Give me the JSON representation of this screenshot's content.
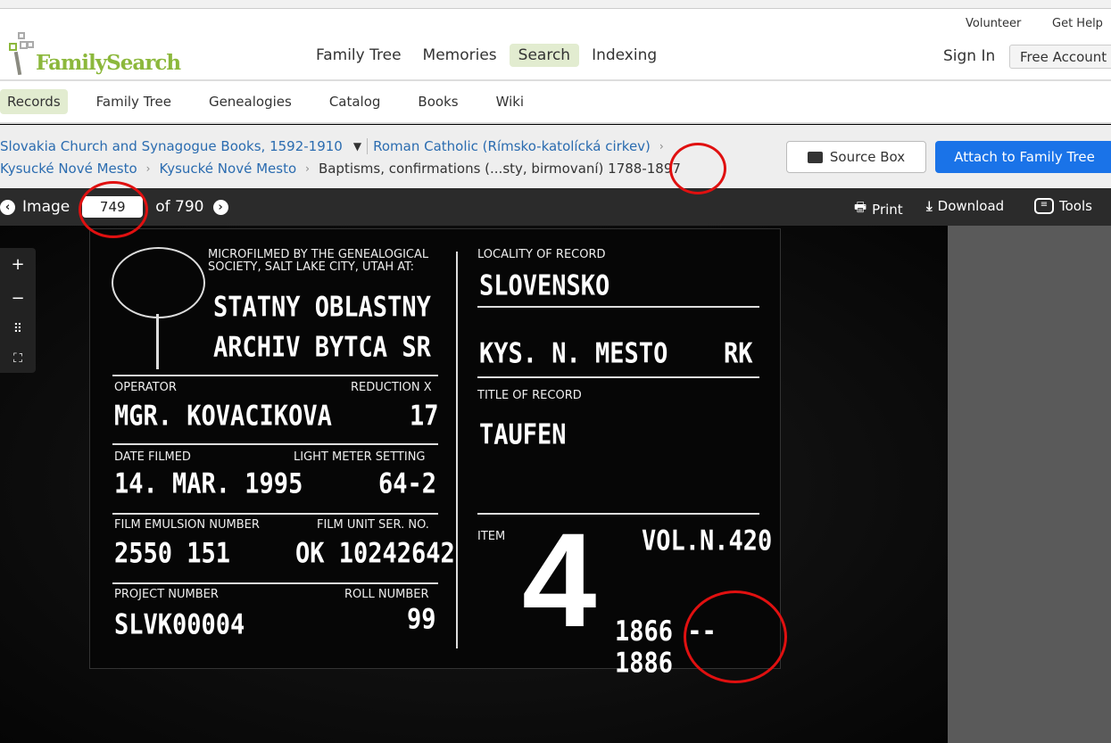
{
  "header": {
    "brand": "FamilySearch",
    "nav": [
      "Family Tree",
      "Memories",
      "Search",
      "Indexing"
    ],
    "active_nav": "Search",
    "volunteer": "Volunteer",
    "get_help": "Get Help",
    "sign_in": "Sign In",
    "free_account": "Free Account"
  },
  "subnav": {
    "items": [
      "Records",
      "Family Tree",
      "Genealogies",
      "Catalog",
      "Books",
      "Wiki"
    ]
  },
  "breadcrumb": {
    "collection": "Slovakia Church and Synagogue Books, 1592-1910",
    "religion": "Roman Catholic (Rímsko-katolícká cirkev)",
    "place1": "Kysucké Nové Mesto",
    "place2": "Kysucké Nové Mesto",
    "record": "Baptisms, confirmations (...sty, birmovaní) 1788-1897"
  },
  "actions": {
    "source_box": "Source Box",
    "attach": "Attach to Family Tree"
  },
  "toolbar": {
    "image_label": "Image",
    "image_number": "749",
    "of_label": "of 790",
    "print": "Print",
    "download": "Download",
    "tools": "Tools"
  },
  "card": {
    "microfilmed_by": "MICROFILMED BY THE GENEALOGICAL SOCIETY, SALT LAKE CITY, UTAH AT:",
    "archive_line1": "STATNY OBLASTNY",
    "archive_line2": "ARCHIV BYTCA SR",
    "operator_label": "OPERATOR",
    "operator": "MGR. KOVACIKOVA",
    "reduction_label": "REDUCTION X",
    "reduction": "17",
    "date_label": "DATE FILMED",
    "date": "14. MAR. 1995",
    "light_label": "LIGHT METER SETTING",
    "light": "64-2",
    "emulsion_label": "FILM EMULSION NUMBER",
    "emulsion": "2550 151",
    "unit_label": "FILM UNIT SER. NO.",
    "unit": "OK 10242642",
    "project_label": "PROJECT NUMBER",
    "project": "SLVK00004",
    "roll_label": "ROLL NUMBER",
    "roll": "99",
    "locality_label": "LOCALITY OF RECORD",
    "locality1": "SLOVENSKO",
    "locality2": "KYS. N. MESTO",
    "locality2b": "RK",
    "title_label": "TITLE OF RECORD",
    "title": "TAUFEN",
    "item_label": "ITEM",
    "item": "4",
    "vol": "VOL.N.420",
    "years": "1866 -- 1886"
  },
  "colors": {
    "brand": "#8cb83c",
    "link": "#2b6cb0",
    "attach": "#1a73e8",
    "annotation": "#e01010"
  }
}
